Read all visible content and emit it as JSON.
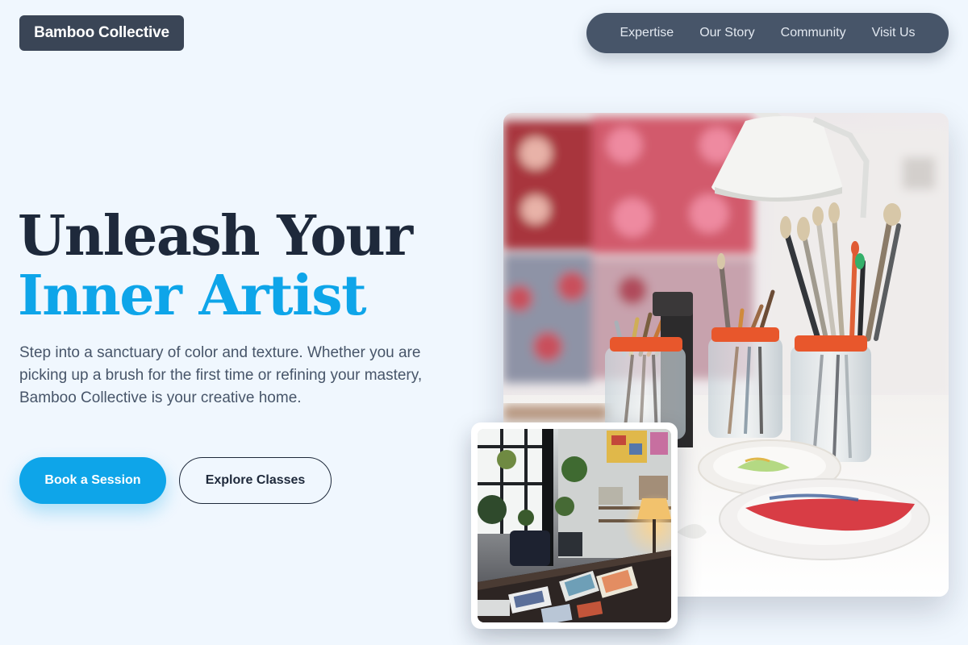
{
  "header": {
    "logo": "Bamboo Collective",
    "nav": [
      "Expertise",
      "Our Story",
      "Community",
      "Visit Us"
    ]
  },
  "hero": {
    "headline_line1": "Unleash Your",
    "headline_line2": "Inner Artist",
    "description": "Step into a sanctuary of color and texture. Whether you are picking up a brush for the first time or refining your mastery, Bamboo Collective is your creative home.",
    "primary_button": "Book a Session",
    "secondary_button": "Explore Classes"
  },
  "colors": {
    "background": "#f0f7fe",
    "accent": "#0ea5e9",
    "nav": "#475569",
    "logo": "#3a4556",
    "heading": "#1e293b"
  },
  "images": {
    "main": "paintbrush-jars-photo",
    "secondary": "art-studio-interior-photo"
  }
}
